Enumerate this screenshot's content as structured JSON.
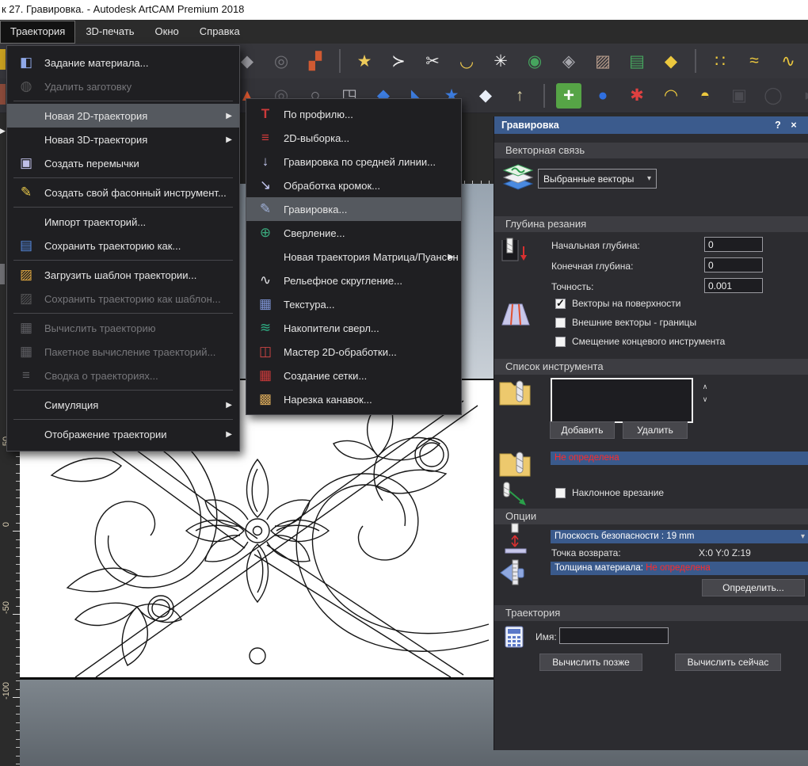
{
  "window": {
    "title": "к 27. Гравировка. - Autodesk ArtCAM Premium 2018"
  },
  "menubar": {
    "items": [
      {
        "label": "Траектория",
        "active": true
      },
      {
        "label": "3D-печать"
      },
      {
        "label": "Окно"
      },
      {
        "label": "Справка"
      }
    ]
  },
  "ui": {
    "submenu_arrow": "▶",
    "dropdown_caret": "▾",
    "spin_up": "∧",
    "spin_down": "∨"
  },
  "toolbars": {
    "row1": [
      {
        "name": "diamond-sculpt",
        "glyph": "◆",
        "color": "#9a9aa0"
      },
      {
        "name": "stamp-oval",
        "glyph": "◎",
        "color": "#6f6f74"
      },
      {
        "name": "color-swatches",
        "glyph": "▞",
        "color": "#d05a32"
      },
      {
        "name": "sep",
        "sep": true
      },
      {
        "name": "open-vector-library",
        "glyph": "★",
        "color": "#eecb5a"
      },
      {
        "name": "vector-chevron",
        "glyph": "≻",
        "color": "#f2f2f2"
      },
      {
        "name": "trim-vectors",
        "glyph": "✂",
        "color": "#e8e8e8"
      },
      {
        "name": "fillet-arc",
        "glyph": "◡",
        "color": "#eec84e"
      },
      {
        "name": "flower-vector",
        "glyph": "✳",
        "color": "#f4f4f4"
      },
      {
        "name": "emboss-oval",
        "glyph": "◉",
        "color": "#46a45e"
      },
      {
        "name": "wrap-relief",
        "glyph": "◈",
        "color": "#a8a8ae"
      },
      {
        "name": "maze-relief",
        "glyph": "▨",
        "color": "#b49a8a"
      },
      {
        "name": "copy-relief",
        "glyph": "▤",
        "color": "#46a45e"
      },
      {
        "name": "stamp-ring",
        "glyph": "◆",
        "color": "#ecc83e"
      },
      {
        "name": "sep",
        "sep": true
      },
      {
        "name": "scatter-circles",
        "glyph": "∷",
        "color": "#ecc83e"
      },
      {
        "name": "dotted-flow",
        "glyph": "≈",
        "color": "#ecc83e"
      },
      {
        "name": "polyline-nodes",
        "glyph": "∿",
        "color": "#ecc83e"
      }
    ],
    "row2": [
      {
        "name": "profile-tool",
        "glyph": "▲",
        "color": "#e05a32"
      },
      {
        "name": "stamp-dark",
        "glyph": "◎",
        "color": "#606066"
      },
      {
        "name": "oval-outline",
        "glyph": "○",
        "color": "#8a8a90"
      },
      {
        "name": "paste-relief",
        "glyph": "◳",
        "color": "#b4b4ba"
      },
      {
        "name": "ribbon-blue",
        "glyph": "◆",
        "color": "#3d7de0"
      },
      {
        "name": "fold-blue",
        "glyph": "◣",
        "color": "#3d7de0"
      },
      {
        "name": "star-blue",
        "glyph": "★",
        "color": "#3d7de0"
      },
      {
        "name": "diamond-two-rail",
        "glyph": "◆",
        "color": "#e8eef8"
      },
      {
        "name": "layer-stack-up",
        "glyph": "↑",
        "color": "#e0d6a8"
      },
      {
        "name": "sep",
        "sep": true
      },
      {
        "name": "add-relief",
        "glyph": "+",
        "color": "#ffffff",
        "bg": "#56a446"
      },
      {
        "name": "blob-blue",
        "glyph": "●",
        "color": "#2f6fe0"
      },
      {
        "name": "hatch-star",
        "glyph": "✱",
        "color": "#e04040"
      },
      {
        "name": "curve-arrow",
        "glyph": "◠",
        "color": "#ecc83e"
      },
      {
        "name": "dome-split",
        "glyph": "◓",
        "color": "#ecc83e"
      },
      {
        "name": "dashed-square",
        "glyph": "▣",
        "color": "#6a6a70",
        "disabled": true
      },
      {
        "name": "circle-tool",
        "glyph": "◯",
        "color": "#6a6a70",
        "disabled": true
      },
      {
        "name": "notch-right",
        "glyph": "◗",
        "color": "#6a6a70",
        "disabled": true
      },
      {
        "name": "notch-left",
        "glyph": "◖",
        "color": "#6a6a70",
        "disabled": true
      }
    ]
  },
  "menu": {
    "items": [
      {
        "label": "Задание материала...",
        "icon": {
          "glyph": "◧",
          "color": "#8fa8e8"
        }
      },
      {
        "label": "Удалить заготовку",
        "disabled": true,
        "icon": {
          "glyph": "◍",
          "color": "#8a8a8a"
        }
      },
      {
        "label": "Новая 2D-траектория",
        "highlighted": true,
        "submenu": true
      },
      {
        "label": "Новая 3D-траектория",
        "submenu": true
      },
      {
        "label": "Создать перемычки",
        "icon": {
          "glyph": "▣",
          "color": "#c0c0e8"
        }
      },
      {
        "label": "Создать свой фасонный инструмент...",
        "icon": {
          "glyph": "✎",
          "color": "#e8c84a"
        }
      },
      {
        "label": "Импорт траекторий..."
      },
      {
        "label": "Сохранить траекторию как...",
        "icon": {
          "glyph": "▤",
          "color": "#5588dd"
        }
      },
      {
        "label": "Загрузить шаблон траектории...",
        "icon": {
          "glyph": "▨",
          "color": "#e0a840"
        }
      },
      {
        "label": "Сохранить траекторию как шаблон...",
        "disabled": true,
        "icon": {
          "glyph": "▨",
          "color": "#8a8a8a"
        }
      },
      {
        "label": "Вычислить траекторию",
        "disabled": true,
        "icon": {
          "glyph": "▦",
          "color": "#9a9aa0"
        }
      },
      {
        "label": "Пакетное вычисление траекторий...",
        "disabled": true,
        "icon": {
          "glyph": "▦",
          "color": "#9a9aa0"
        }
      },
      {
        "label": "Сводка о траекториях...",
        "disabled": true,
        "icon": {
          "glyph": "≡",
          "color": "#9a9aa0"
        }
      },
      {
        "label": "Симуляция",
        "submenu": true
      },
      {
        "label": "Отображение траектории",
        "submenu": true
      }
    ]
  },
  "submenu": {
    "items": [
      {
        "label": "По профилю...",
        "icon": {
          "glyph": "Т",
          "color": "#cc3a3a"
        }
      },
      {
        "label": "2D-выборка...",
        "icon": {
          "glyph": "≡",
          "color": "#cc3a3a"
        }
      },
      {
        "label": "Гравировка по средней линии...",
        "icon": {
          "glyph": "↓",
          "color": "#c3c7ef"
        }
      },
      {
        "label": "Обработка кромок...",
        "icon": {
          "glyph": "↘",
          "color": "#c3c7ef"
        }
      },
      {
        "label": "Гравировка...",
        "highlighted": true,
        "icon": {
          "glyph": "✎",
          "color": "#9fb0d8"
        }
      },
      {
        "label": "Сверление...",
        "icon": {
          "glyph": "⊕",
          "color": "#3aa87c"
        }
      },
      {
        "label": "Новая траектория Матрица/Пуансон",
        "submenu": true
      },
      {
        "label": "Рельефное скругление...",
        "icon": {
          "glyph": "∿",
          "color": "#e4e4e8"
        }
      },
      {
        "label": "Текстура...",
        "icon": {
          "glyph": "▦",
          "color": "#7f96d8"
        }
      },
      {
        "label": "Накопители сверл...",
        "icon": {
          "glyph": "≋",
          "color": "#2fae84"
        }
      },
      {
        "label": "Мастер 2D-обработки...",
        "icon": {
          "glyph": "◫",
          "color": "#cc4444"
        }
      },
      {
        "label": "Создание сетки...",
        "icon": {
          "glyph": "▦",
          "color": "#cc3a3a"
        }
      },
      {
        "label": "Нарезка канавок...",
        "icon": {
          "glyph": "▩",
          "color": "#d8a85a"
        }
      }
    ]
  },
  "panel": {
    "title": "Гравировка",
    "help_label": "?",
    "close_label": "×",
    "vector_link": {
      "header": "Векторная связь",
      "selector_value": "Выбранные векторы"
    },
    "cut_depth": {
      "header": "Глубина резания",
      "fields": [
        {
          "label": "Начальная глубина:",
          "value": "0"
        },
        {
          "label": "Конечная глубина:",
          "value": "0"
        },
        {
          "label": "Точность:",
          "value": "0.001"
        }
      ],
      "checks": [
        {
          "label": "Векторы на поверхности",
          "checked": true
        },
        {
          "label": "Внешние векторы - границы",
          "checked": false
        },
        {
          "label": "Смещение концевого инструмента",
          "checked": false
        }
      ]
    },
    "tool_list": {
      "header": "Список инструмента",
      "add_label": "Добавить",
      "remove_label": "Удалить",
      "tool_status": "Не определена",
      "ramp_label": "Наклонное врезание",
      "ramp_checked": false
    },
    "options": {
      "header": "Опции",
      "safe_plane": "Плоскость безопасности : 19 mm",
      "return_label": "Точка возврата:",
      "return_value": "X:0 Y:0 Z:19",
      "thickness_label": "Толщина материала:",
      "thickness_status": "Не определена",
      "define_label": "Определить..."
    },
    "toolpath": {
      "header": "Траектория",
      "name_label": "Имя:",
      "name_value": "",
      "later_label": "Вычислить позже",
      "now_label": "Вычислить сейчас"
    }
  },
  "ruler": {
    "v_labels": [
      "50",
      "0",
      "-50",
      "-100"
    ]
  },
  "colors": {
    "panel_header_blue": "#3b5b8d",
    "highlight_bar_blue": "#3a5a8c",
    "warning_red": "#ff2a2a"
  }
}
